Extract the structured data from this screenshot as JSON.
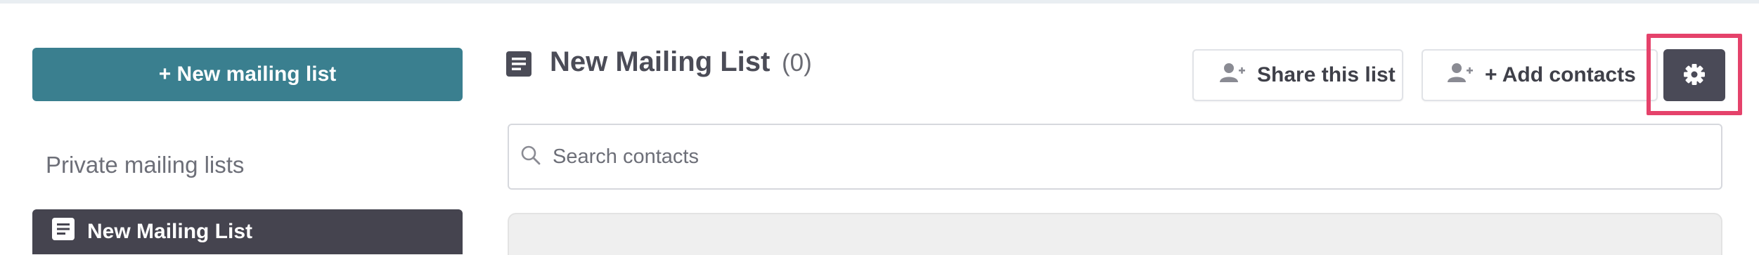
{
  "sidebar": {
    "new_list_label": "+ New mailing list",
    "section_label": "Private mailing lists",
    "items": [
      {
        "label": "New Mailing List",
        "icon": "list-icon",
        "active": true
      }
    ]
  },
  "header": {
    "title": "New Mailing List",
    "count": "(0)",
    "title_icon": "list-icon"
  },
  "toolbar": {
    "share_label": "Share this list",
    "share_icon": "user-plus-icon",
    "add_label": "+ Add contacts",
    "add_icon": "user-plus-icon",
    "settings_icon": "gear-icon"
  },
  "search": {
    "placeholder": "Search contacts",
    "value": "",
    "icon": "search-icon"
  },
  "colors": {
    "primary_button": "#3a7f8f",
    "dark_button": "#4a4a57",
    "active_item": "#45444f",
    "highlight": "#e5426b",
    "text_dark": "#4b4c57",
    "text_muted": "#6d6f78"
  }
}
